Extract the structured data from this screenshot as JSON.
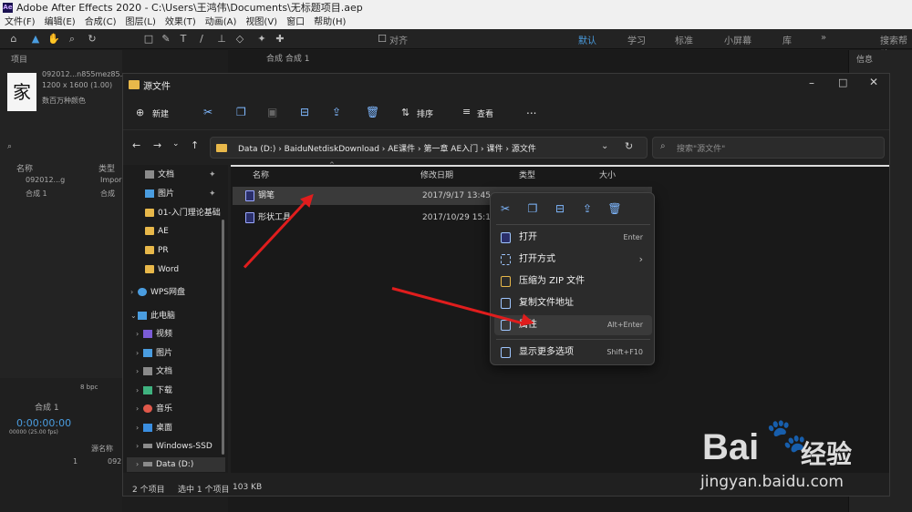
{
  "ae": {
    "title": "Adobe After Effects 2020 - C:\\Users\\王鸿伟\\Documents\\无标题项目.aep",
    "logo": "Ae",
    "menu": [
      "文件(F)",
      "编辑(E)",
      "合成(C)",
      "图层(L)",
      "效果(T)",
      "动画(A)",
      "视图(V)",
      "窗口",
      "帮助(H)"
    ],
    "workspaces": [
      "默认",
      "学习",
      "标准",
      "小屏幕",
      "库"
    ],
    "search_help": "搜索帮助",
    "align": "对齐",
    "project_label": "项目",
    "comp_tab": "合成 合成 1",
    "info_label": "信息",
    "asset_name": "092012...n855mez85...",
    "asset_size": "1200 x 1600 (1.00)",
    "asset_desc": "数百万种颜色",
    "asset_char": "家",
    "col_name": "名称",
    "col_type": "类型",
    "file1": "092012...g",
    "file1_type": "Impor",
    "file2": "合成 1",
    "file2_type": "合成",
    "bpc": "8 bpc",
    "timeline_tab": "合成 1",
    "timecode": "0:00:00:00",
    "fps": "00000 (25.00 fps)",
    "layer_col": "源名称",
    "layer_num": "1",
    "layer_name": "092"
  },
  "explorer": {
    "title": "源文件",
    "new_label": "新建",
    "sort_label": "排序",
    "view_label": "查看",
    "more": "...",
    "breadcrumb": [
      "Data (D:)",
      "BaiduNetdiskDownload",
      "AE课件",
      "第一章 AE入门",
      "课件",
      "源文件"
    ],
    "search_placeholder": "搜索\"源文件\"",
    "nav": [
      {
        "label": "文档",
        "pinned": true
      },
      {
        "label": "图片",
        "pinned": true
      },
      {
        "label": "01-入门理论基础"
      },
      {
        "label": "AE"
      },
      {
        "label": "PR"
      },
      {
        "label": "Word"
      },
      {
        "label": "WPS网盘"
      },
      {
        "label": "此电脑"
      },
      {
        "label": "视频"
      },
      {
        "label": "图片"
      },
      {
        "label": "文档"
      },
      {
        "label": "下载"
      },
      {
        "label": "音乐"
      },
      {
        "label": "桌面"
      },
      {
        "label": "Windows-SSD"
      },
      {
        "label": "Data (D:)"
      }
    ],
    "columns": [
      "名称",
      "修改日期",
      "类型",
      "大小"
    ],
    "files": [
      {
        "name": "钢笔",
        "date": "2017/9/17 13:45"
      },
      {
        "name": "形状工具",
        "date": "2017/10/29 15:13"
      }
    ],
    "status_count": "2 个项目",
    "status_sel": "选中 1 个项目",
    "status_size": "103 KB"
  },
  "context_menu": {
    "items": [
      {
        "label": "打开",
        "shortcut": "Enter"
      },
      {
        "label": "打开方式",
        "shortcut": "›"
      },
      {
        "label": "压缩为 ZIP 文件",
        "shortcut": ""
      },
      {
        "label": "复制文件地址",
        "shortcut": ""
      },
      {
        "label": "属性",
        "shortcut": "Alt+Enter"
      },
      {
        "label": "显示更多选项",
        "shortcut": "Shift+F10"
      }
    ]
  },
  "watermark": {
    "brand": "Bai",
    "brand2": "经验",
    "url": "jingyan.baidu.com"
  },
  "colors": {
    "arrow": "#e01d1d",
    "accent": "#7fb8ff",
    "folder": "#e8b84a"
  }
}
